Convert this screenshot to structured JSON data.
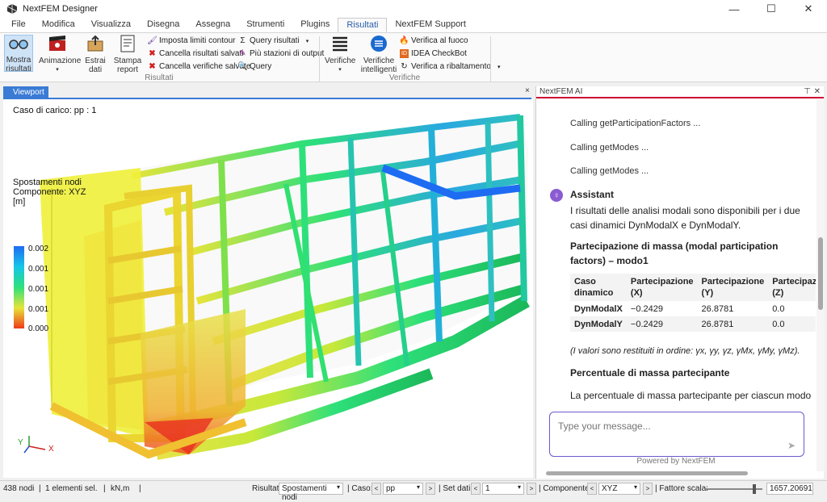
{
  "window": {
    "title": "NextFEM Designer",
    "min": "—",
    "max": "☐",
    "close": "✕"
  },
  "menu": [
    "File",
    "Modifica",
    "Visualizza",
    "Disegna",
    "Assegna",
    "Strumenti",
    "Plugins",
    "Risultati",
    "NextFEM Support"
  ],
  "ribbon": {
    "mostra": "Mostra\nrisultati",
    "animazione": "Animazione",
    "estrai": "Estrai\ndati",
    "stampa": "Stampa\nreport",
    "imposta": "Imposta limiti contour",
    "cancella_ris": "Cancella risultati salvati",
    "cancella_ver": "Cancella verifiche salvate",
    "query_ris": "Query risultati",
    "piu_staz": "Più stazioni di output",
    "query": "Query",
    "verifiche": "Verifiche",
    "verifiche_int": "Verifiche\nintelligenti",
    "verifica_fuoco": "Verifica al fuoco",
    "idea": "IDEA CheckBot",
    "ribaltamento": "Verifica a ribaltamento",
    "group_risultati": "Risultati",
    "group_verifiche": "Verifiche"
  },
  "viewport": {
    "tab": "Viewport",
    "close": "×",
    "caso": "Caso di carico: pp : 1",
    "spost": [
      "Spostamenti nodi",
      "Componente: XYZ",
      "[m]"
    ],
    "legend": [
      "0.002",
      "0.001",
      "0.001",
      "0.001",
      "0.000"
    ],
    "axis_y": "Y",
    "axis_x": "X"
  },
  "ai": {
    "title": "NextFEM AI",
    "pin": "📌",
    "close": "✕",
    "calls": [
      "Calling getParticipationFactors ...",
      "Calling getModes ...",
      "Calling getModes ..."
    ],
    "assistant": "Assistant",
    "p1": "I risultati delle analisi modali sono disponibili per i due casi dinamici DynModalX e DynModalY.",
    "h1": "Partecipazione di massa (modal participation factors) – modo1",
    "table": {
      "headers": [
        "Caso dinamico",
        "Partecipazione (X)",
        "Partecipazione (Y)",
        "Partecipazione (Z)"
      ],
      "rows": [
        [
          "DynModalX",
          "−0.2429",
          "26.8781",
          "0.0"
        ],
        [
          "DynModalY",
          "−0.2429",
          "26.8781",
          "0.0"
        ]
      ]
    },
    "note": "(I valori sono restituiti in ordine: γx, γy, γz, γMx, γMy, γMz).",
    "h2": "Percentuale di massa partecipante",
    "p2": "La percentuale di massa partecipante per ciascun modo è:",
    "placeholder": "Type your message...",
    "powered": "Powered by NextFEM"
  },
  "status": {
    "nodi": "438 nodi",
    "elementi": "1 elementi sel.",
    "unita": "kN,m",
    "risultati_lab": "Risultati:",
    "risultati_val": "Spostamenti nodi",
    "caso_lab": "| Caso:",
    "caso_val": "pp",
    "set_lab": "| Set dati:",
    "set_val": "1",
    "comp_lab": "| Componente:",
    "comp_val": "XYZ",
    "fattore_lab": "| Fattore scala:",
    "fattore_val": "1657.20691"
  },
  "colors": {
    "accent": "#3a7bd5",
    "ai_border": "#c03030",
    "input_border": "#6a5acd"
  }
}
